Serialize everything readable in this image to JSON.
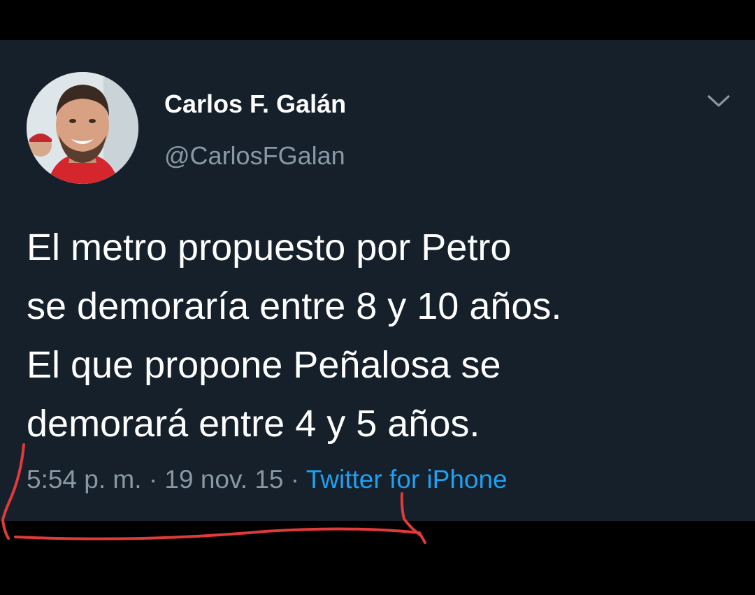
{
  "tweet": {
    "author": {
      "display_name": "Carlos F. Galán",
      "handle": "@CarlosFGalan"
    },
    "menu_icon": "chevron-down-icon",
    "text": "El metro propuesto por Petro\nse demoraría entre 8 y 10 años.\nEl que propone Peñalosa se\ndemorará entre 4 y 5 años.",
    "time": "5:54 p. m.",
    "separator": "·",
    "date": "19 nov. 15",
    "source": "Twitter for iPhone"
  },
  "colors": {
    "background": "#000000",
    "card": "#15202b",
    "text": "#ffffff",
    "muted": "#8899a6",
    "link": "#1da1f2",
    "annotation": "#e03a3a"
  }
}
